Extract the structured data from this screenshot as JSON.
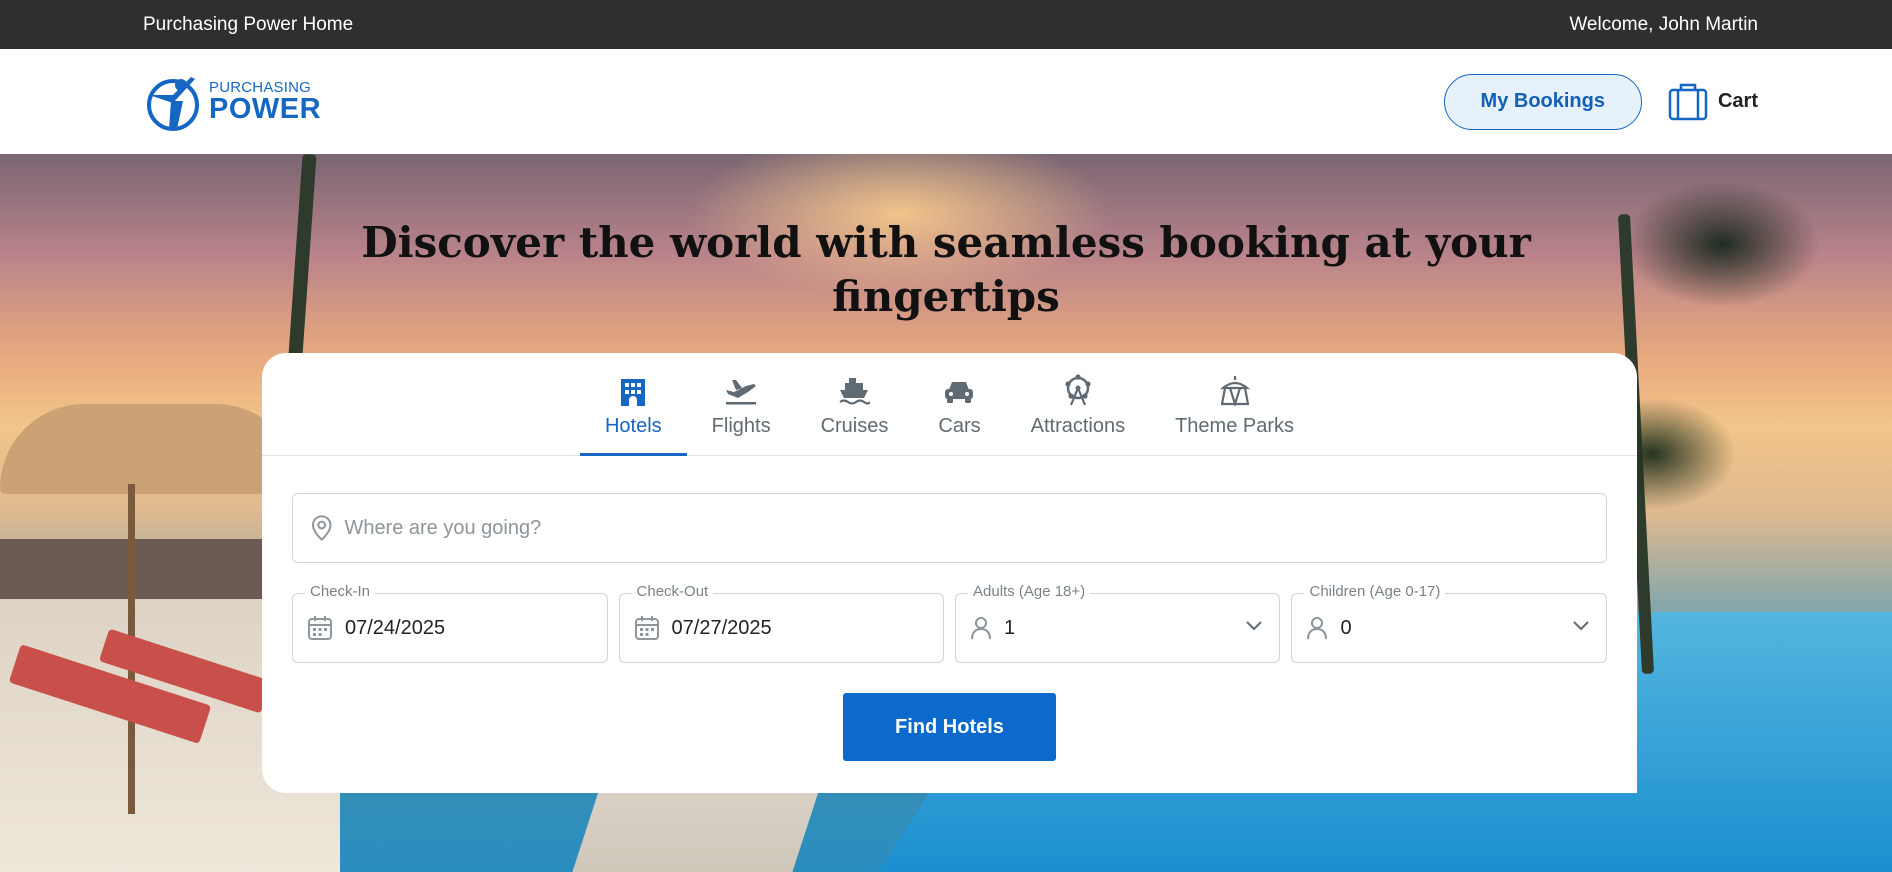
{
  "topbar": {
    "home_link": "Purchasing Power Home",
    "welcome": "Welcome, John Martin"
  },
  "header": {
    "logo": {
      "small": "PURCHASING",
      "big": "POWER"
    },
    "my_bookings_label": "My Bookings",
    "cart_label": "Cart"
  },
  "hero": {
    "title_line1": "Discover the world with seamless booking at your",
    "title_line2": "fingertips"
  },
  "tabs": [
    {
      "label": "Hotels",
      "icon": "hotel-icon",
      "active": true
    },
    {
      "label": "Flights",
      "icon": "plane-icon"
    },
    {
      "label": "Cruises",
      "icon": "ship-icon"
    },
    {
      "label": "Cars",
      "icon": "car-icon"
    },
    {
      "label": "Attractions",
      "icon": "ferris-wheel-icon"
    },
    {
      "label": "Theme Parks",
      "icon": "tent-icon"
    }
  ],
  "search": {
    "destination_placeholder": "Where are you going?",
    "checkin": {
      "label": "Check-In",
      "value": "07/24/2025"
    },
    "checkout": {
      "label": "Check-Out",
      "value": "07/27/2025"
    },
    "adults": {
      "label": "Adults (Age 18+)",
      "value": "1"
    },
    "children": {
      "label": "Children (Age 0-17)",
      "value": "0"
    },
    "submit_label": "Find Hotels"
  },
  "colors": {
    "accent": "#1667c4",
    "topbar": "#2f2f2f",
    "button": "#0b6acc"
  }
}
